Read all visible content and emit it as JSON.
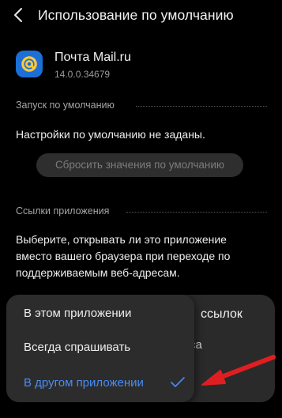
{
  "header": {
    "title": "Использование по умолчанию"
  },
  "app": {
    "name": "Почта Mail.ru",
    "version": "14.0.0.34679"
  },
  "default_launch": {
    "section_title": "Запуск по умолчанию",
    "status_text": "Настройки по умолчанию не заданы.",
    "reset_label": "Сбросить значения по умолчанию"
  },
  "app_links": {
    "section_title": "Ссылки приложения",
    "description": "Выберите, открывать ли это приложение вместо вашего браузера при переходе по поддерживаемым веб-адресам.",
    "underlay_fragment_1": "ссылок",
    "underlay_fragment_2": "са"
  },
  "popup": {
    "options": [
      {
        "label": "В этом приложении",
        "selected": false
      },
      {
        "label": "Всегда спрашивать",
        "selected": false
      },
      {
        "label": "В другом приложении",
        "selected": true
      }
    ]
  },
  "colors": {
    "accent": "#4a8cf5",
    "annotation_arrow": "#e01e22",
    "app_icon": "#1b6fd6"
  }
}
